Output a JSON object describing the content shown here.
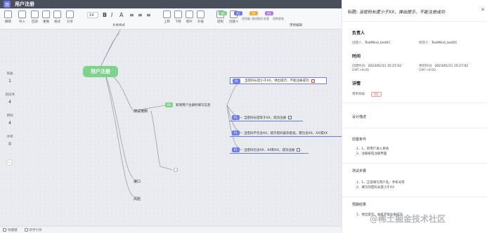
{
  "app": {
    "logo_text": "用",
    "title": "用户注册"
  },
  "toolbar": {
    "items": [
      {
        "label": "撤销",
        "icon": "undo-icon"
      },
      {
        "label": "导入",
        "icon": "import-icon"
      },
      {
        "label": "回退",
        "icon": "back-icon"
      },
      {
        "label": "重做",
        "icon": "redo-icon"
      },
      {
        "label": "格式",
        "icon": "format-brush-icon"
      },
      {
        "label": "协同",
        "icon": "collab-icon"
      },
      {
        "label": "分享",
        "icon": "share-icon"
      }
    ],
    "font_size": "14",
    "group_label_text": "文本样式",
    "insert_items": [
      {
        "label": "上移",
        "icon": "move-up-icon"
      },
      {
        "label": "下移",
        "icon": "move-down-icon"
      },
      {
        "label": "图片",
        "icon": "image-icon"
      },
      {
        "label": "外链",
        "icon": "link-icon"
      }
    ],
    "view_items": [
      {
        "label": "结构",
        "icon": "structure-icon"
      },
      {
        "label": "创建人",
        "icon": "creator-icon"
      },
      {
        "label": "测试用例",
        "icon": "testcase-icon"
      }
    ],
    "tag_chips": [
      {
        "text": "P0",
        "color": "#7ed38a"
      },
      {
        "text": "P1",
        "color": "#6b7cf0"
      },
      {
        "text": "P2",
        "color": "#f0a93b"
      },
      {
        "text": "P3",
        "color": "#b57bea"
      }
    ],
    "tag_labels": [
      "优先级",
      "测试报告",
      "标签",
      "用例状态"
    ],
    "tag_group_label": "用例编辑"
  },
  "canvas": {
    "root": "用户注册",
    "branches": [
      {
        "label": "测试用例"
      },
      {
        "label": "接口"
      },
      {
        "label": "风险"
      }
    ],
    "mid_node": {
      "badge": "P0",
      "text": "新增用户注册时填写信息"
    },
    "leaves": [
      {
        "badge": "P1",
        "text": "当密码长度小于XX，弹出提示，不能注册成功",
        "selected": true
      },
      {
        "badge": "P1",
        "text": "当密码长度等于XX，成功注册",
        "selected": false
      },
      {
        "badge": "P1",
        "text": "当密码不包含XX，提示密码复杂度低，需包含XX、XX或XX",
        "selected": false
      },
      {
        "badge": "P1",
        "text": "当密码包含XX、XX和XX，成功注册",
        "selected": false
      }
    ]
  },
  "left_counters": [
    {
      "label": "等级",
      "value": "1"
    },
    {
      "label": "测试项",
      "value": "4"
    },
    {
      "label": "用例",
      "value": "4"
    },
    {
      "label": "评审",
      "value": "0"
    }
  ],
  "bottom_bar": {
    "items": [
      "快捷键",
      "新手引导"
    ]
  },
  "panel": {
    "title_label": "标题:",
    "title": "当密码长度小于XX，弹出提示，不能注册成功",
    "section_owner": "负责人",
    "creator_label": "创建人:",
    "creator": "TestMind_test01",
    "modifier_label": "修改人:",
    "modifier": "TestMind_test01",
    "section_time": "时间",
    "created_label": "创建时间:",
    "created_time": "2023/01/11 15:27:02",
    "created_tz": "GMT+8:00",
    "updated_label": "更新时间:",
    "updated_time": "2023/01/11 15:27:02",
    "updated_tz": "GMT+8:00",
    "section_detail": "详情",
    "level_label": "用例等级:",
    "level_value": "P1",
    "design_desc": "设计描述",
    "precondition_title": "前置条件",
    "preconditions": [
      "1、1、新用户进入系统",
      "2、注册按钮注册界面"
    ],
    "steps_title": "测试步骤",
    "steps": [
      "1、1、正常填写用户名、手机号等",
      "2、填写的密码长度小于XX"
    ],
    "expected_title": "预期结果",
    "expected": [
      "1、弹出提示，并且不能注册成功"
    ]
  },
  "watermark": "@稀土掘金技术社区"
}
